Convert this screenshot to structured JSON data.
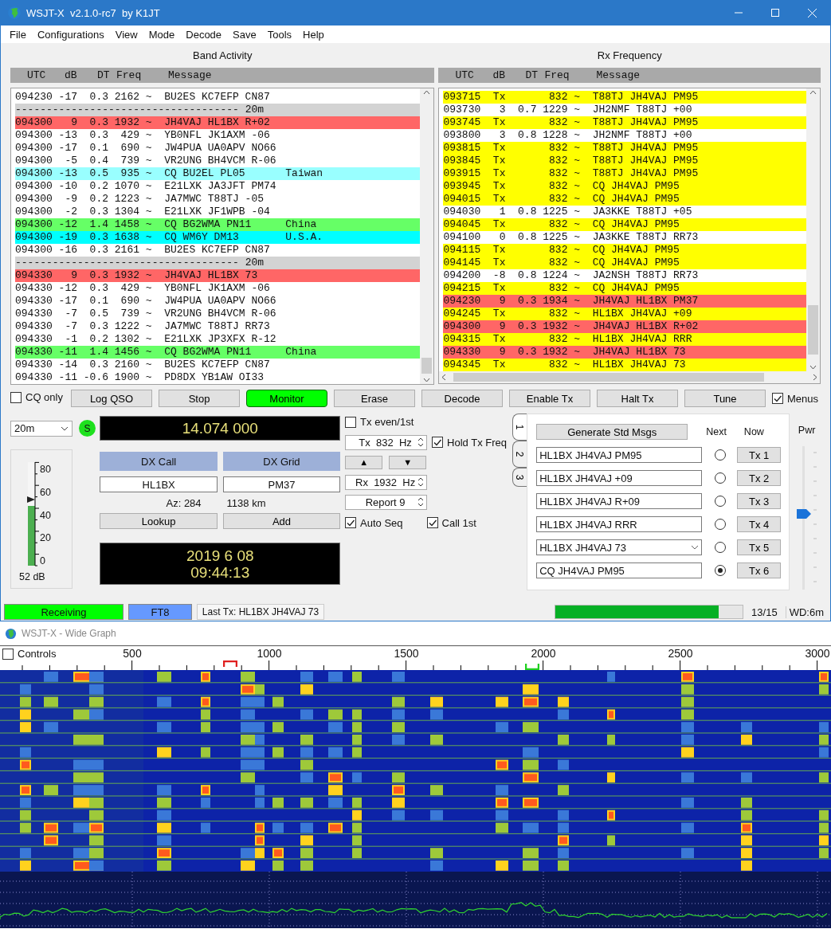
{
  "window": {
    "title": "WSJT-X  v2.1.0-rc7  by K1JT"
  },
  "menu": [
    "File",
    "Configurations",
    "View",
    "Mode",
    "Decode",
    "Save",
    "Tools",
    "Help"
  ],
  "band_activity": {
    "title": "Band Activity",
    "columns": [
      "UTC",
      "dB",
      "DT",
      "Freq",
      "Message"
    ],
    "rows": [
      {
        "kind": "decode",
        "utc": "094230",
        "db": "-17",
        "dt": "0.3",
        "freq": "2162",
        "flag": "~",
        "message": "BU2ES KC7EFP CN87",
        "color": "#ffffff"
      },
      {
        "kind": "separator",
        "text": "------------------------------------ 20m",
        "color": "#d3d3d3"
      },
      {
        "kind": "decode",
        "utc": "094300",
        "db": "9",
        "dt": "0.3",
        "freq": "1932",
        "flag": "~",
        "message": "JH4VAJ HL1BX R+02",
        "color": "#ff6666"
      },
      {
        "kind": "decode",
        "utc": "094300",
        "db": "-13",
        "dt": "0.3",
        "freq": "429",
        "flag": "~",
        "message": "YB0NFL JK1AXM -06",
        "color": "#ffffff"
      },
      {
        "kind": "decode",
        "utc": "094300",
        "db": "-17",
        "dt": "0.1",
        "freq": "690",
        "flag": "~",
        "message": "JW4PUA UA0APV NO66",
        "color": "#ffffff"
      },
      {
        "kind": "decode",
        "utc": "094300",
        "db": "-5",
        "dt": "0.4",
        "freq": "739",
        "flag": "~",
        "message": "VR2UNG BH4VCM R-06",
        "color": "#ffffff"
      },
      {
        "kind": "decode",
        "utc": "094300",
        "db": "-13",
        "dt": "0.5",
        "freq": "935",
        "flag": "~",
        "message": "CQ BU2EL PL05",
        "country": "Taiwan",
        "color": "#99ffff"
      },
      {
        "kind": "decode",
        "utc": "094300",
        "db": "-10",
        "dt": "0.2",
        "freq": "1070",
        "flag": "~",
        "message": "E21LXK JA3JFT PM74",
        "color": "#ffffff"
      },
      {
        "kind": "decode",
        "utc": "094300",
        "db": "-9",
        "dt": "0.2",
        "freq": "1223",
        "flag": "~",
        "message": "JA7MWC T88TJ -05",
        "color": "#ffffff"
      },
      {
        "kind": "decode",
        "utc": "094300",
        "db": "-2",
        "dt": "0.3",
        "freq": "1304",
        "flag": "~",
        "message": "E21LXK JF1WPB -04",
        "color": "#ffffff"
      },
      {
        "kind": "decode",
        "utc": "094300",
        "db": "-12",
        "dt": "1.4",
        "freq": "1458",
        "flag": "~",
        "message": "CQ BG2WMA PN11",
        "country": "China",
        "color": "#66ff66"
      },
      {
        "kind": "decode",
        "utc": "094300",
        "db": "-19",
        "dt": "0.3",
        "freq": "1638",
        "flag": "~",
        "message": "CQ WM6Y DM13",
        "country": "U.S.A.",
        "color": "#00ffff"
      },
      {
        "kind": "decode",
        "utc": "094300",
        "db": "-16",
        "dt": "0.3",
        "freq": "2161",
        "flag": "~",
        "message": "BU2ES KC7EFP CN87",
        "color": "#ffffff"
      },
      {
        "kind": "separator",
        "text": "------------------------------------ 20m",
        "color": "#d3d3d3"
      },
      {
        "kind": "decode",
        "utc": "094330",
        "db": "9",
        "dt": "0.3",
        "freq": "1932",
        "flag": "~",
        "message": "JH4VAJ HL1BX 73",
        "color": "#ff6666"
      },
      {
        "kind": "decode",
        "utc": "094330",
        "db": "-12",
        "dt": "0.3",
        "freq": "429",
        "flag": "~",
        "message": "YB0NFL JK1AXM -06",
        "color": "#ffffff"
      },
      {
        "kind": "decode",
        "utc": "094330",
        "db": "-17",
        "dt": "0.1",
        "freq": "690",
        "flag": "~",
        "message": "JW4PUA UA0APV NO66",
        "color": "#ffffff"
      },
      {
        "kind": "decode",
        "utc": "094330",
        "db": "-7",
        "dt": "0.5",
        "freq": "739",
        "flag": "~",
        "message": "VR2UNG BH4VCM R-06",
        "color": "#ffffff"
      },
      {
        "kind": "decode",
        "utc": "094330",
        "db": "-7",
        "dt": "0.3",
        "freq": "1222",
        "flag": "~",
        "message": "JA7MWC T88TJ RR73",
        "color": "#ffffff"
      },
      {
        "kind": "decode",
        "utc": "094330",
        "db": "-1",
        "dt": "0.2",
        "freq": "1302",
        "flag": "~",
        "message": "E21LXK JP3XFX R-12",
        "color": "#ffffff"
      },
      {
        "kind": "decode",
        "utc": "094330",
        "db": "-11",
        "dt": "1.4",
        "freq": "1456",
        "flag": "~",
        "message": "CQ BG2WMA PN11",
        "country": "China",
        "color": "#66ff66"
      },
      {
        "kind": "decode",
        "utc": "094330",
        "db": "-14",
        "dt": "0.3",
        "freq": "2160",
        "flag": "~",
        "message": "BU2ES KC7EFP CN87",
        "color": "#ffffff"
      },
      {
        "kind": "decode",
        "utc": "094330",
        "db": "-11",
        "dt": "-0.6",
        "freq": "1900",
        "flag": "~",
        "message": "PD8DX YB1AW OI33",
        "color": "#ffffff"
      }
    ]
  },
  "rx_frequency": {
    "title": "Rx Frequency",
    "columns": [
      "UTC",
      "dB",
      "DT",
      "Freq",
      "Message"
    ],
    "rows": [
      {
        "utc": "093715",
        "db": "Tx",
        "freq": "832",
        "flag": "~",
        "message": "T88TJ JH4VAJ PM95",
        "color": "#ffff00"
      },
      {
        "utc": "093730",
        "db": "3",
        "dt": "0.7",
        "freq": "1229",
        "flag": "~",
        "message": "JH2NMF T88TJ +00",
        "color": "#ffffff"
      },
      {
        "utc": "093745",
        "db": "Tx",
        "freq": "832",
        "flag": "~",
        "message": "T88TJ JH4VAJ PM95",
        "color": "#ffff00"
      },
      {
        "utc": "093800",
        "db": "3",
        "dt": "0.8",
        "freq": "1228",
        "flag": "~",
        "message": "JH2NMF T88TJ +00",
        "color": "#ffffff"
      },
      {
        "utc": "093815",
        "db": "Tx",
        "freq": "832",
        "flag": "~",
        "message": "T88TJ JH4VAJ PM95",
        "color": "#ffff00"
      },
      {
        "utc": "093845",
        "db": "Tx",
        "freq": "832",
        "flag": "~",
        "message": "T88TJ JH4VAJ PM95",
        "color": "#ffff00"
      },
      {
        "utc": "093915",
        "db": "Tx",
        "freq": "832",
        "flag": "~",
        "message": "T88TJ JH4VAJ PM95",
        "color": "#ffff00"
      },
      {
        "utc": "093945",
        "db": "Tx",
        "freq": "832",
        "flag": "~",
        "message": "CQ JH4VAJ PM95",
        "color": "#ffff00"
      },
      {
        "utc": "094015",
        "db": "Tx",
        "freq": "832",
        "flag": "~",
        "message": "CQ JH4VAJ PM95",
        "color": "#ffff00"
      },
      {
        "utc": "094030",
        "db": "1",
        "dt": "0.8",
        "freq": "1225",
        "flag": "~",
        "message": "JA3KKE T88TJ +05",
        "color": "#ffffff"
      },
      {
        "utc": "094045",
        "db": "Tx",
        "freq": "832",
        "flag": "~",
        "message": "CQ JH4VAJ PM95",
        "color": "#ffff00"
      },
      {
        "utc": "094100",
        "db": "0",
        "dt": "0.8",
        "freq": "1225",
        "flag": "~",
        "message": "JA3KKE T88TJ RR73",
        "color": "#ffffff"
      },
      {
        "utc": "094115",
        "db": "Tx",
        "freq": "832",
        "flag": "~",
        "message": "CQ JH4VAJ PM95",
        "color": "#ffff00"
      },
      {
        "utc": "094145",
        "db": "Tx",
        "freq": "832",
        "flag": "~",
        "message": "CQ JH4VAJ PM95",
        "color": "#ffff00"
      },
      {
        "utc": "094200",
        "db": "-8",
        "dt": "0.8",
        "freq": "1224",
        "flag": "~",
        "message": "JA2NSH T88TJ RR73",
        "color": "#ffffff"
      },
      {
        "utc": "094215",
        "db": "Tx",
        "freq": "832",
        "flag": "~",
        "message": "CQ JH4VAJ PM95",
        "color": "#ffff00"
      },
      {
        "utc": "094230",
        "db": "9",
        "dt": "0.3",
        "freq": "1934",
        "flag": "~",
        "message": "JH4VAJ HL1BX PM37",
        "color": "#ff6666"
      },
      {
        "utc": "094245",
        "db": "Tx",
        "freq": "832",
        "flag": "~",
        "message": "HL1BX JH4VAJ +09",
        "color": "#ffff00"
      },
      {
        "utc": "094300",
        "db": "9",
        "dt": "0.3",
        "freq": "1932",
        "flag": "~",
        "message": "JH4VAJ HL1BX R+02",
        "color": "#ff6666"
      },
      {
        "utc": "094315",
        "db": "Tx",
        "freq": "832",
        "flag": "~",
        "message": "HL1BX JH4VAJ RRR",
        "color": "#ffff00"
      },
      {
        "utc": "094330",
        "db": "9",
        "dt": "0.3",
        "freq": "1932",
        "flag": "~",
        "message": "JH4VAJ HL1BX 73",
        "color": "#ff6666"
      },
      {
        "utc": "094345",
        "db": "Tx",
        "freq": "832",
        "flag": "~",
        "message": "HL1BX JH4VAJ 73",
        "color": "#ffff00"
      }
    ]
  },
  "cq_only": {
    "label": "CQ only",
    "checked": false
  },
  "buttons": [
    {
      "label": "Log QSO",
      "on": false
    },
    {
      "label": "Stop",
      "on": false
    },
    {
      "label": "Monitor",
      "on": true
    },
    {
      "label": "Erase",
      "on": false
    },
    {
      "label": "Decode",
      "on": false
    },
    {
      "label": "Enable Tx",
      "on": false
    },
    {
      "label": "Halt Tx",
      "on": false
    },
    {
      "label": "Tune",
      "on": false
    }
  ],
  "menus_toggle": {
    "label": "Menus",
    "checked": true
  },
  "band": "20m",
  "s_indicator": "S",
  "meter": {
    "labels": [
      "80",
      "60",
      "40",
      "20",
      "0"
    ],
    "level": 0.58,
    "reading": "52 dB"
  },
  "dial_frequency": "14.074 000",
  "dx_call": {
    "label": "DX Call",
    "value": "HL1BX"
  },
  "dx_grid": {
    "label": "DX Grid",
    "value": "PM37"
  },
  "azimuth": "Az: 284",
  "distance": "1138 km",
  "lookup_button": "Lookup",
  "add_button": "Add",
  "clock": {
    "date": "2019 6 08",
    "time": "09:44:13"
  },
  "tx_even": {
    "label": "Tx even/1st",
    "checked": false
  },
  "tx_freq": "Tx  832  Hz",
  "hold_tx_freq": {
    "label": "Hold Tx Freq",
    "checked": true
  },
  "arrows": [
    "▲",
    "▼"
  ],
  "rx_freq": "Rx  1932  Hz",
  "report": "Report 9",
  "auto_seq": {
    "label": "Auto Seq",
    "checked": true
  },
  "call_first": {
    "label": "Call 1st",
    "checked": true
  },
  "message_tabs": [
    {
      "label": "1",
      "selected": true
    },
    {
      "label": "2",
      "selected": false
    },
    {
      "label": "3",
      "selected": false
    }
  ],
  "messages": {
    "generate_button": "Generate Std Msgs",
    "next_label": "Next",
    "now_label": "Now",
    "rows": [
      {
        "kind": "field",
        "text": "HL1BX JH4VAJ PM95",
        "selected": false,
        "button": "Tx 1"
      },
      {
        "kind": "field",
        "text": "HL1BX JH4VAJ +09",
        "selected": false,
        "button": "Tx 2"
      },
      {
        "kind": "field",
        "text": "HL1BX JH4VAJ R+09",
        "selected": false,
        "button": "Tx 3"
      },
      {
        "kind": "field",
        "text": "HL1BX JH4VAJ RRR",
        "selected": false,
        "button": "Tx 4"
      },
      {
        "kind": "dropdown",
        "text": "HL1BX JH4VAJ 73",
        "selected": false,
        "button": "Tx 5"
      },
      {
        "kind": "field",
        "text": "CQ JH4VAJ PM95",
        "selected": true,
        "button": "Tx 6"
      }
    ]
  },
  "power": {
    "label": "Pwr",
    "level": 0.53
  },
  "status_bar": {
    "state": "Receiving",
    "mode": "FT8",
    "last_tx": "Last Tx: HL1BX JH4VAJ 73",
    "progress": {
      "level": 0.87,
      "reading": "13/15"
    },
    "watchdog": "WD:6m"
  },
  "wide_graph": {
    "title": "WSJT-X - Wide Graph",
    "controls": {
      "label": "Controls",
      "checked": false
    },
    "scale_labels": [
      "500",
      "1000",
      "1500",
      "2000",
      "2500",
      "3000"
    ]
  }
}
